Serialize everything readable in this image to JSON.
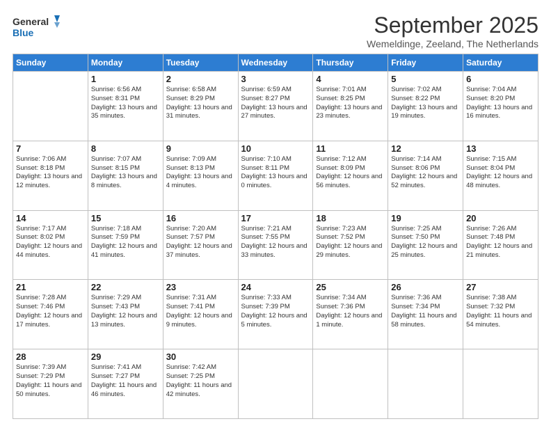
{
  "logo": {
    "line1": "General",
    "line2": "Blue"
  },
  "title": "September 2025",
  "subtitle": "Wemeldinge, Zeeland, The Netherlands",
  "days_of_week": [
    "Sunday",
    "Monday",
    "Tuesday",
    "Wednesday",
    "Thursday",
    "Friday",
    "Saturday"
  ],
  "weeks": [
    [
      {
        "day": "",
        "sunrise": "",
        "sunset": "",
        "daylight": ""
      },
      {
        "day": "1",
        "sunrise": "Sunrise: 6:56 AM",
        "sunset": "Sunset: 8:31 PM",
        "daylight": "Daylight: 13 hours and 35 minutes."
      },
      {
        "day": "2",
        "sunrise": "Sunrise: 6:58 AM",
        "sunset": "Sunset: 8:29 PM",
        "daylight": "Daylight: 13 hours and 31 minutes."
      },
      {
        "day": "3",
        "sunrise": "Sunrise: 6:59 AM",
        "sunset": "Sunset: 8:27 PM",
        "daylight": "Daylight: 13 hours and 27 minutes."
      },
      {
        "day": "4",
        "sunrise": "Sunrise: 7:01 AM",
        "sunset": "Sunset: 8:25 PM",
        "daylight": "Daylight: 13 hours and 23 minutes."
      },
      {
        "day": "5",
        "sunrise": "Sunrise: 7:02 AM",
        "sunset": "Sunset: 8:22 PM",
        "daylight": "Daylight: 13 hours and 19 minutes."
      },
      {
        "day": "6",
        "sunrise": "Sunrise: 7:04 AM",
        "sunset": "Sunset: 8:20 PM",
        "daylight": "Daylight: 13 hours and 16 minutes."
      }
    ],
    [
      {
        "day": "7",
        "sunrise": "Sunrise: 7:06 AM",
        "sunset": "Sunset: 8:18 PM",
        "daylight": "Daylight: 13 hours and 12 minutes."
      },
      {
        "day": "8",
        "sunrise": "Sunrise: 7:07 AM",
        "sunset": "Sunset: 8:15 PM",
        "daylight": "Daylight: 13 hours and 8 minutes."
      },
      {
        "day": "9",
        "sunrise": "Sunrise: 7:09 AM",
        "sunset": "Sunset: 8:13 PM",
        "daylight": "Daylight: 13 hours and 4 minutes."
      },
      {
        "day": "10",
        "sunrise": "Sunrise: 7:10 AM",
        "sunset": "Sunset: 8:11 PM",
        "daylight": "Daylight: 13 hours and 0 minutes."
      },
      {
        "day": "11",
        "sunrise": "Sunrise: 7:12 AM",
        "sunset": "Sunset: 8:09 PM",
        "daylight": "Daylight: 12 hours and 56 minutes."
      },
      {
        "day": "12",
        "sunrise": "Sunrise: 7:14 AM",
        "sunset": "Sunset: 8:06 PM",
        "daylight": "Daylight: 12 hours and 52 minutes."
      },
      {
        "day": "13",
        "sunrise": "Sunrise: 7:15 AM",
        "sunset": "Sunset: 8:04 PM",
        "daylight": "Daylight: 12 hours and 48 minutes."
      }
    ],
    [
      {
        "day": "14",
        "sunrise": "Sunrise: 7:17 AM",
        "sunset": "Sunset: 8:02 PM",
        "daylight": "Daylight: 12 hours and 44 minutes."
      },
      {
        "day": "15",
        "sunrise": "Sunrise: 7:18 AM",
        "sunset": "Sunset: 7:59 PM",
        "daylight": "Daylight: 12 hours and 41 minutes."
      },
      {
        "day": "16",
        "sunrise": "Sunrise: 7:20 AM",
        "sunset": "Sunset: 7:57 PM",
        "daylight": "Daylight: 12 hours and 37 minutes."
      },
      {
        "day": "17",
        "sunrise": "Sunrise: 7:21 AM",
        "sunset": "Sunset: 7:55 PM",
        "daylight": "Daylight: 12 hours and 33 minutes."
      },
      {
        "day": "18",
        "sunrise": "Sunrise: 7:23 AM",
        "sunset": "Sunset: 7:52 PM",
        "daylight": "Daylight: 12 hours and 29 minutes."
      },
      {
        "day": "19",
        "sunrise": "Sunrise: 7:25 AM",
        "sunset": "Sunset: 7:50 PM",
        "daylight": "Daylight: 12 hours and 25 minutes."
      },
      {
        "day": "20",
        "sunrise": "Sunrise: 7:26 AM",
        "sunset": "Sunset: 7:48 PM",
        "daylight": "Daylight: 12 hours and 21 minutes."
      }
    ],
    [
      {
        "day": "21",
        "sunrise": "Sunrise: 7:28 AM",
        "sunset": "Sunset: 7:46 PM",
        "daylight": "Daylight: 12 hours and 17 minutes."
      },
      {
        "day": "22",
        "sunrise": "Sunrise: 7:29 AM",
        "sunset": "Sunset: 7:43 PM",
        "daylight": "Daylight: 12 hours and 13 minutes."
      },
      {
        "day": "23",
        "sunrise": "Sunrise: 7:31 AM",
        "sunset": "Sunset: 7:41 PM",
        "daylight": "Daylight: 12 hours and 9 minutes."
      },
      {
        "day": "24",
        "sunrise": "Sunrise: 7:33 AM",
        "sunset": "Sunset: 7:39 PM",
        "daylight": "Daylight: 12 hours and 5 minutes."
      },
      {
        "day": "25",
        "sunrise": "Sunrise: 7:34 AM",
        "sunset": "Sunset: 7:36 PM",
        "daylight": "Daylight: 12 hours and 1 minute."
      },
      {
        "day": "26",
        "sunrise": "Sunrise: 7:36 AM",
        "sunset": "Sunset: 7:34 PM",
        "daylight": "Daylight: 11 hours and 58 minutes."
      },
      {
        "day": "27",
        "sunrise": "Sunrise: 7:38 AM",
        "sunset": "Sunset: 7:32 PM",
        "daylight": "Daylight: 11 hours and 54 minutes."
      }
    ],
    [
      {
        "day": "28",
        "sunrise": "Sunrise: 7:39 AM",
        "sunset": "Sunset: 7:29 PM",
        "daylight": "Daylight: 11 hours and 50 minutes."
      },
      {
        "day": "29",
        "sunrise": "Sunrise: 7:41 AM",
        "sunset": "Sunset: 7:27 PM",
        "daylight": "Daylight: 11 hours and 46 minutes."
      },
      {
        "day": "30",
        "sunrise": "Sunrise: 7:42 AM",
        "sunset": "Sunset: 7:25 PM",
        "daylight": "Daylight: 11 hours and 42 minutes."
      },
      {
        "day": "",
        "sunrise": "",
        "sunset": "",
        "daylight": ""
      },
      {
        "day": "",
        "sunrise": "",
        "sunset": "",
        "daylight": ""
      },
      {
        "day": "",
        "sunrise": "",
        "sunset": "",
        "daylight": ""
      },
      {
        "day": "",
        "sunrise": "",
        "sunset": "",
        "daylight": ""
      }
    ]
  ]
}
